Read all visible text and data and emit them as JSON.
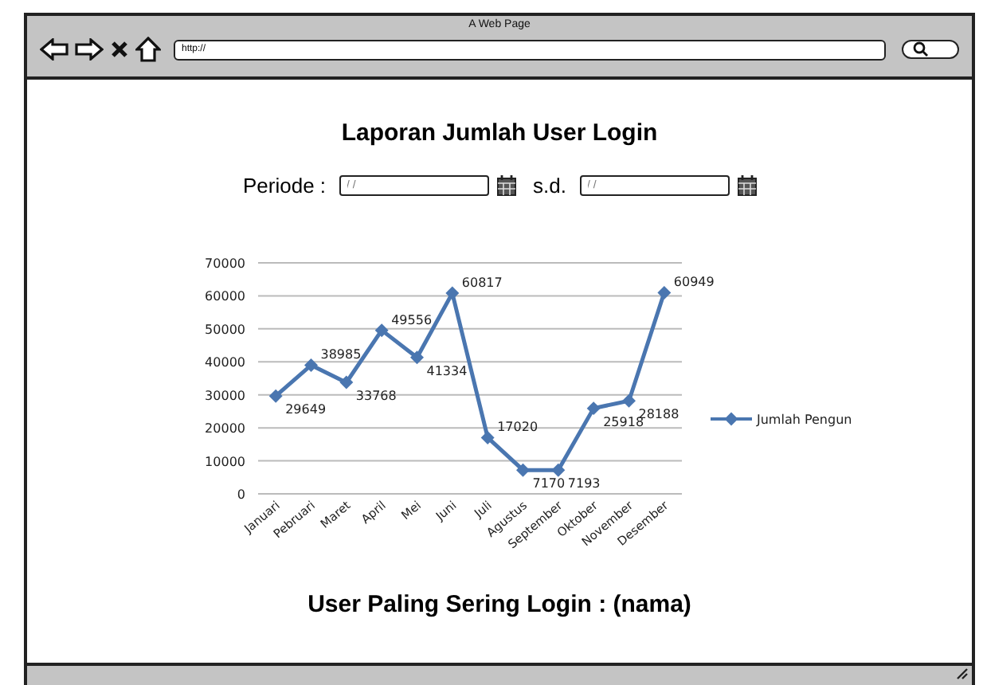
{
  "window": {
    "title": "A Web Page",
    "url": "http://"
  },
  "report": {
    "title": "Laporan Jumlah User Login",
    "period_label": "Periode :",
    "from": {
      "placeholder": "/ /"
    },
    "separator": "s.d.",
    "to": {
      "placeholder": "/ /"
    },
    "chart_data": {
      "type": "line",
      "categories": [
        "Januari",
        "Pebruari",
        "Maret",
        "April",
        "Mei",
        "Juni",
        "Juli",
        "Agustus",
        "September",
        "Oktober",
        "November",
        "Desember"
      ],
      "series": [
        {
          "name": "Jumlah Pengun",
          "color": "#4a76b0",
          "marker": "diamond",
          "values": [
            29649,
            38985,
            33768,
            49556,
            41334,
            60817,
            17020,
            7170,
            7193,
            25918,
            28188,
            60949
          ]
        }
      ],
      "ylim": [
        0,
        70000
      ],
      "grid": true,
      "yticks": [
        0,
        10000,
        20000,
        30000,
        40000,
        50000,
        60000,
        70000
      ],
      "data_labels": true
    },
    "footer_text": "User Paling Sering Login : (nama)"
  }
}
